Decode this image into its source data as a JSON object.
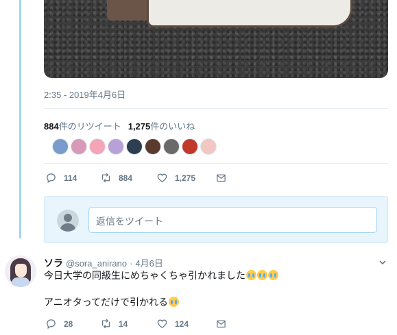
{
  "tweet": {
    "timestamp": "2:35 - 2019年4月6日",
    "retweet_count": "884",
    "retweet_label": "件のリツイート",
    "like_count": "1,275",
    "like_label": "件のいいね",
    "actions": {
      "reply": "114",
      "retweet": "884",
      "like": "1,275"
    },
    "liker_avatar_colors": [
      "#7a9ccc",
      "#d99ab8",
      "#f4a5b8",
      "#b8a1d9",
      "#2c3e50",
      "#5b3a2e",
      "#6a6a6a",
      "#c0392b",
      "#f2c6c2"
    ]
  },
  "reply_box": {
    "placeholder": "返信をツイート"
  },
  "reply": {
    "name": "ソラ",
    "handle": "@sora_anirano",
    "dot": "·",
    "date": "4月6日",
    "line1": "今日大学の同級生にめちゃくちゃ引かれました",
    "line2": "アニオタってだけで引かれる",
    "actions": {
      "reply": "28",
      "retweet": "14",
      "like": "124"
    }
  },
  "icons": {
    "reply": "reply-icon",
    "retweet": "retweet-icon",
    "like": "heart-icon",
    "dm": "envelope-icon",
    "more": "chevron-down-icon",
    "emoji": "crying-face-emoji"
  },
  "colors": {
    "thread_line": "#a3d3f5",
    "reply_box_bg": "#e8f5fd",
    "muted": "#657786"
  }
}
